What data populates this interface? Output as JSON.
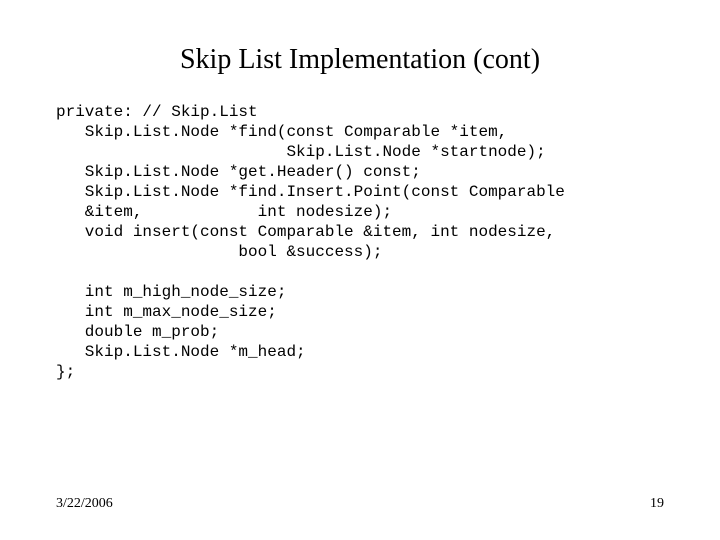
{
  "title": "Skip List Implementation (cont)",
  "code": {
    "l1": "private: // Skip.List",
    "l2": "   Skip.List.Node *find(const Comparable *item,",
    "l3": "                        Skip.List.Node *startnode);",
    "l4": "   Skip.List.Node *get.Header() const;",
    "l5": "   Skip.List.Node *find.Insert.Point(const Comparable",
    "l6": "   &item,            int nodesize);",
    "l7": "   void insert(const Comparable &item, int nodesize,",
    "l8": "                   bool &success);",
    "l9": "",
    "l10": "   int m_high_node_size;",
    "l11": "   int m_max_node_size;",
    "l12": "   double m_prob;",
    "l13": "   Skip.List.Node *m_head;",
    "l14": "};"
  },
  "footer": {
    "date": "3/22/2006",
    "page": "19"
  }
}
